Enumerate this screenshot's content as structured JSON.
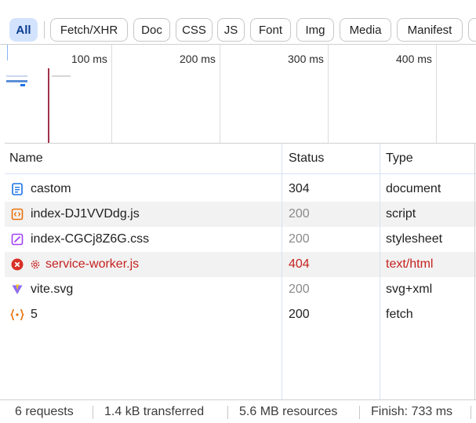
{
  "filters": [
    {
      "label": "All",
      "active": true
    },
    {
      "label": "Fetch/XHR",
      "active": false
    },
    {
      "label": "Doc",
      "active": false
    },
    {
      "label": "CSS",
      "active": false
    },
    {
      "label": "JS",
      "active": false
    },
    {
      "label": "Font",
      "active": false
    },
    {
      "label": "Img",
      "active": false
    },
    {
      "label": "Media",
      "active": false
    },
    {
      "label": "Manifest",
      "active": false
    }
  ],
  "overview": {
    "ticks": [
      "100 ms",
      "200 ms",
      "300 ms",
      "400 ms"
    ]
  },
  "table": {
    "headers": {
      "name": "Name",
      "status": "Status",
      "type": "Type"
    },
    "rows": [
      {
        "icon": "document-icon",
        "name": "castom",
        "status": "304",
        "type": "document",
        "muted_status": false,
        "error": false
      },
      {
        "icon": "script-icon",
        "name": "index-DJ1VVDdg.js",
        "status": "200",
        "type": "script",
        "muted_status": true,
        "error": false
      },
      {
        "icon": "stylesheet-icon",
        "name": "index-CGCj8Z6G.css",
        "status": "200",
        "type": "stylesheet",
        "muted_status": true,
        "error": false
      },
      {
        "icon": "error-icon",
        "name": "service-worker.js",
        "status": "404",
        "type": "text/html",
        "muted_status": false,
        "error": true
      },
      {
        "icon": "vite-icon",
        "name": "vite.svg",
        "status": "200",
        "type": "svg+xml",
        "muted_status": true,
        "error": false
      },
      {
        "icon": "fetch-icon",
        "name": "5",
        "status": "200",
        "type": "fetch",
        "muted_status": false,
        "error": false
      }
    ]
  },
  "status_bar": {
    "requests": "6 requests",
    "transferred": "1.4 kB transferred",
    "resources": "5.6 MB resources",
    "finish": "Finish: 733 ms"
  },
  "colors": {
    "accent": "#d3e3fd",
    "error": "#c5221f",
    "load_line": "#a0324b"
  }
}
